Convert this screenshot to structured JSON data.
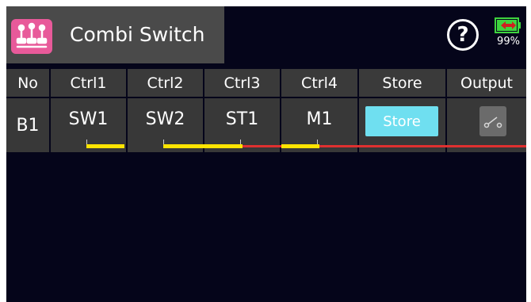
{
  "header": {
    "title": "Combi Switch",
    "help_label": "?",
    "battery_percent": "99%",
    "battery_level": 0.99,
    "icon": "combi-switch-icon"
  },
  "table": {
    "columns": [
      "No",
      "Ctrl1",
      "Ctrl2",
      "Ctrl3",
      "Ctrl4",
      "Store",
      "Output"
    ],
    "row": {
      "no": "B1",
      "ctrl1": "SW1",
      "ctrl2": "SW2",
      "ctrl3": "ST1",
      "ctrl4": "M1",
      "store_label": "Store",
      "output_icon": "switch-open-icon"
    }
  },
  "colors": {
    "background": "#05051a",
    "header_bg": "#4a4a4a",
    "app_icon": "#e85a9a",
    "store_button": "#6fdff0",
    "indicator_active": "#ffe400",
    "indicator_line": "#e03030",
    "battery": "#3ed43e"
  }
}
